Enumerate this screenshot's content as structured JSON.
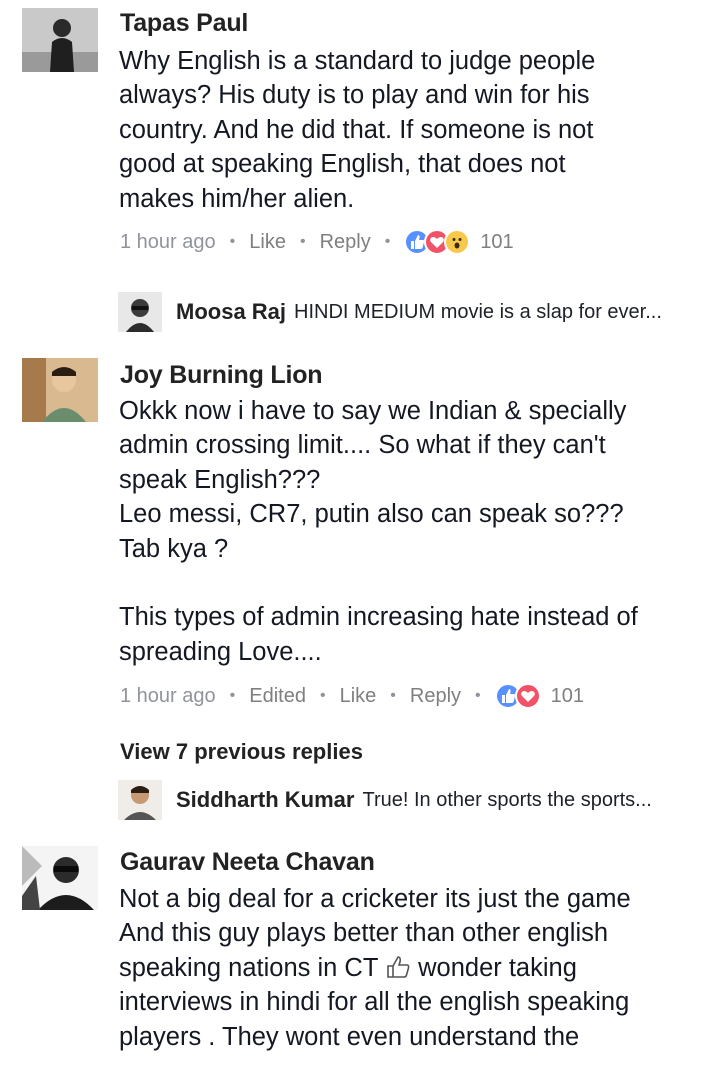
{
  "comments": [
    {
      "author": "Tapas Paul",
      "lines": [
        "Why English is a standard to judge people",
        "always? His duty is to play and win for his",
        "country. And he did that. If someone is not",
        "good at speaking English, that does not",
        "makes him/her alien."
      ],
      "meta": {
        "time": "1 hour ago",
        "like": "Like",
        "reply": "Reply",
        "reaction_count": "101"
      },
      "reactions": [
        "like-icon",
        "love-icon",
        "wow-icon"
      ],
      "reply_preview": {
        "name": "Moosa Raj",
        "text": "HINDI MEDIUM movie is a slap for ever..."
      }
    },
    {
      "author": "Joy Burning Lion",
      "lines": [
        "Okkk now i have to say we Indian & specially",
        "admin crossing limit.... So what if they can't",
        "speak English???",
        "Leo messi, CR7, putin also can speak so???",
        "Tab kya ?",
        "",
        "This types of admin increasing hate instead of",
        "spreading Love...."
      ],
      "meta": {
        "time": "1 hour ago",
        "edited": "Edited",
        "like": "Like",
        "reply": "Reply",
        "reaction_count": "101"
      },
      "reactions": [
        "like-icon",
        "love-icon"
      ],
      "view_more": "View 7 previous replies",
      "reply_preview": {
        "name": "Siddharth Kumar",
        "text": "True! In other sports the sports..."
      }
    },
    {
      "author": "Gaurav Neeta Chavan",
      "lines": [
        "Not a big deal for a cricketer its just the game",
        "And this guy plays better than other english",
        "speaking nations in CT",
        "wonder taking",
        "interviews in hindi for all the english speaking",
        "players . They wont even understand the"
      ],
      "inline_icon": "thumbs-up-outline-icon"
    }
  ],
  "colors": {
    "like": "#5890ff",
    "love": "#f25268",
    "wow": "#f7c84b",
    "meta": "#90949c"
  }
}
